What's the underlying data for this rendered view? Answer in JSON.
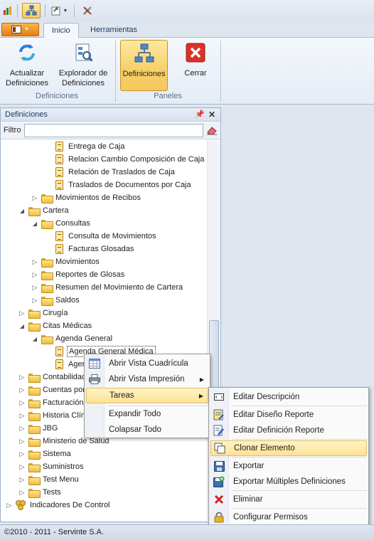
{
  "ribbon": {
    "tabs": [
      "Inicio",
      "Herramientas"
    ],
    "groups": [
      {
        "label": "Definiciones",
        "buttons": [
          "Actualizar Definiciones",
          "Explorador de Definiciones"
        ]
      },
      {
        "label": "Paneles",
        "buttons": [
          "Definiciones",
          "Cerrar"
        ]
      }
    ],
    "buttons": {
      "actualizar": "Actualizar\nDefiniciones",
      "explorador": "Explorador de\nDefiniciones",
      "definiciones": "Definiciones",
      "cerrar": "Cerrar"
    },
    "group_labels": {
      "definiciones": "Definiciones",
      "paneles": "Paneles"
    }
  },
  "panel": {
    "title": "Definiciones",
    "filter_label": "Filtro",
    "filter_value": "",
    "tree": [
      {
        "label": "Entrega de Caja",
        "icon": "document-icon"
      },
      {
        "label": "Relacion Cambio Composición de Caja",
        "icon": "document-icon"
      },
      {
        "label": "Relación de Traslados de Caja",
        "icon": "document-icon"
      },
      {
        "label": "Traslados de Documentos por Caja",
        "icon": "document-icon"
      },
      {
        "label": "Movimientos de Recibos",
        "icon": "folder-icon",
        "state": "collapsed"
      },
      {
        "label": "Cartera",
        "icon": "folder-icon",
        "state": "expanded"
      },
      {
        "label": "Consultas",
        "icon": "folder-icon",
        "state": "expanded"
      },
      {
        "label": "Consulta de Movimientos",
        "icon": "document-icon"
      },
      {
        "label": "Facturas Glosadas",
        "icon": "document-icon"
      },
      {
        "label": "Movimientos",
        "icon": "folder-icon",
        "state": "collapsed"
      },
      {
        "label": "Reportes de Glosas",
        "icon": "folder-icon",
        "state": "collapsed"
      },
      {
        "label": "Resumen del Movimiento de Cartera",
        "icon": "folder-icon",
        "state": "collapsed"
      },
      {
        "label": "Saldos",
        "icon": "folder-icon",
        "state": "collapsed"
      },
      {
        "label": "Cirugía",
        "icon": "folder-icon",
        "state": "collapsed"
      },
      {
        "label": "Citas Médicas",
        "icon": "folder-icon",
        "state": "expanded"
      },
      {
        "label": "Agenda General",
        "icon": "folder-icon",
        "state": "expanded"
      },
      {
        "label": "Agenda General Médica",
        "icon": "document-icon",
        "focused": true
      },
      {
        "label": "Agen",
        "icon": "document-icon"
      },
      {
        "label": "Contabilidad",
        "icon": "folder-icon",
        "state": "collapsed"
      },
      {
        "label": "Cuentas por",
        "icon": "folder-icon",
        "state": "collapsed"
      },
      {
        "label": "Facturación",
        "icon": "folder-icon",
        "state": "collapsed"
      },
      {
        "label": "Historia Clíni",
        "icon": "folder-icon",
        "state": "collapsed"
      },
      {
        "label": "JBG",
        "icon": "folder-icon",
        "state": "collapsed"
      },
      {
        "label": "Ministerio de Salud",
        "icon": "folder-icon",
        "state": "collapsed"
      },
      {
        "label": "Sistema",
        "icon": "folder-icon",
        "state": "collapsed"
      },
      {
        "label": "Suministros",
        "icon": "folder-icon",
        "state": "collapsed"
      },
      {
        "label": "Test Menu",
        "icon": "folder-icon",
        "state": "collapsed"
      },
      {
        "label": "Tests",
        "icon": "folder-icon",
        "state": "collapsed"
      },
      {
        "label": "Indicadores De Control",
        "icon": "node-group-icon",
        "state": "collapsed"
      }
    ]
  },
  "context_menu": {
    "items": [
      "Abrir Vista Cuadrícula",
      "Abrir Vista Impresión",
      "Tareas",
      "Expandir Todo",
      "Colapsar Todo"
    ],
    "highlighted": "Tareas"
  },
  "submenu": {
    "items": [
      "Editar Descripción",
      "Editar Diseño Reporte",
      "Editar Definición Reporte",
      "Clonar Elemento",
      "Exportar",
      "Exportar Múltiples Definiciones",
      "Eliminar",
      "Configurar Permisos"
    ],
    "highlighted": "Clonar Elemento"
  },
  "status": {
    "text": "©2010 - 2011 - Servinte S.A."
  },
  "colors": {
    "accent": "#f6c75f",
    "file_menu": "#e97c0c",
    "ribbon_bg": "#e4ecf6"
  }
}
